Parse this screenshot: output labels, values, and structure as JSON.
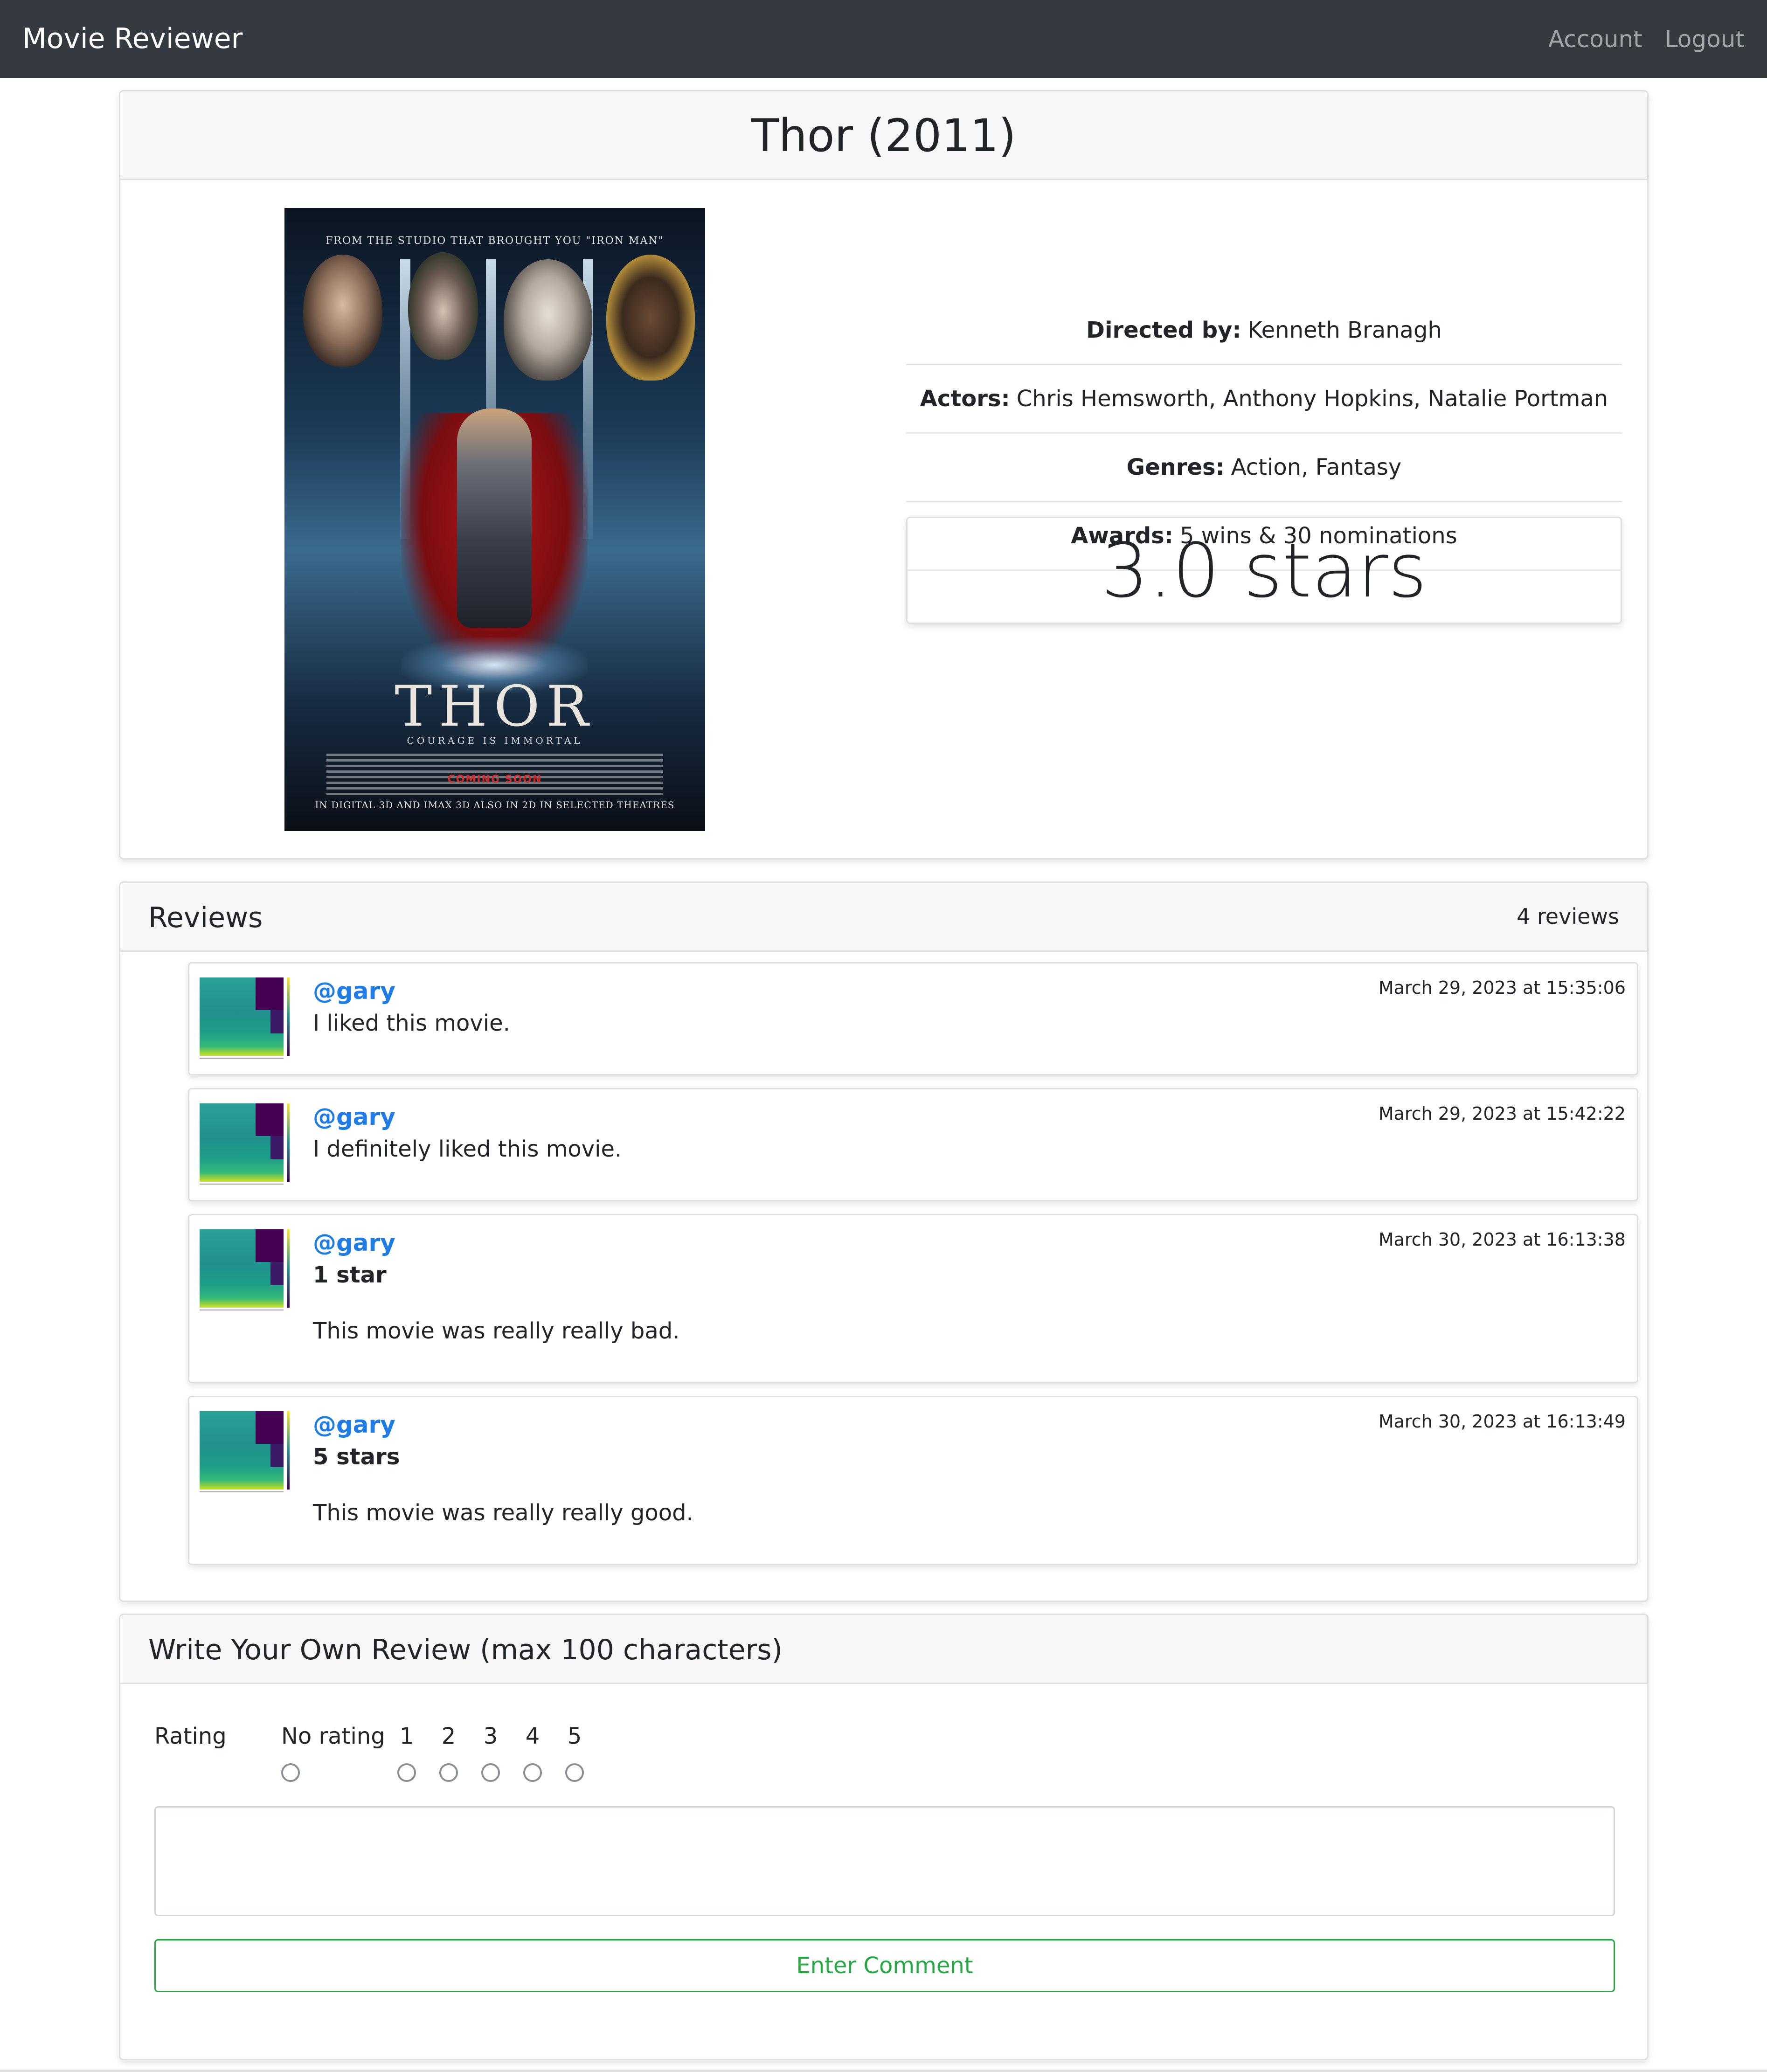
{
  "navbar": {
    "brand": "Movie Reviewer",
    "links": [
      "Account",
      "Logout"
    ]
  },
  "movie": {
    "title": "Thor (2011)",
    "poster": {
      "tagline_top": "FROM THE STUDIO THAT BROUGHT YOU \"IRON MAN\"",
      "title_word": "THOR",
      "subtitle": "COURAGE IS IMMORTAL",
      "coming_soon": "COMING SOON",
      "footer": "IN DIGITAL 3D AND IMAX 3D ALSO IN 2D IN SELECTED THEATRES"
    },
    "details": [
      {
        "label": "Directed by:",
        "value": "Kenneth Branagh"
      },
      {
        "label": "Actors:",
        "value": "Chris Hemsworth, Anthony Hopkins, Natalie Portman"
      },
      {
        "label": "Genres:",
        "value": "Action, Fantasy"
      },
      {
        "label": "Awards:",
        "value": "5 wins & 30 nominations"
      }
    ],
    "rating": "3.0 stars"
  },
  "reviews": {
    "header": "Reviews",
    "count": "4 reviews",
    "items": [
      {
        "user": "@gary",
        "stars": "",
        "text": "I liked this movie.",
        "date": "March 29, 2023 at 15:35:06"
      },
      {
        "user": "@gary",
        "stars": "",
        "text": "I definitely liked this movie.",
        "date": "March 29, 2023 at 15:42:22"
      },
      {
        "user": "@gary",
        "stars": "1 star",
        "text": "This movie was really really bad.",
        "date": "March 30, 2023 at 16:13:38"
      },
      {
        "user": "@gary",
        "stars": "5 stars",
        "text": "This movie was really really good.",
        "date": "March 30, 2023 at 16:13:49"
      }
    ]
  },
  "write_review": {
    "header": "Write Your Own Review (max 100 characters)",
    "rating_label": "Rating",
    "rating_options": [
      "No rating",
      "1",
      "2",
      "3",
      "4",
      "5"
    ],
    "comment_value": "",
    "submit_label": "Enter Comment"
  },
  "colors": {
    "navbar_bg": "#343a40",
    "link_blue": "#1e7ce4",
    "success_green": "#28a745"
  }
}
